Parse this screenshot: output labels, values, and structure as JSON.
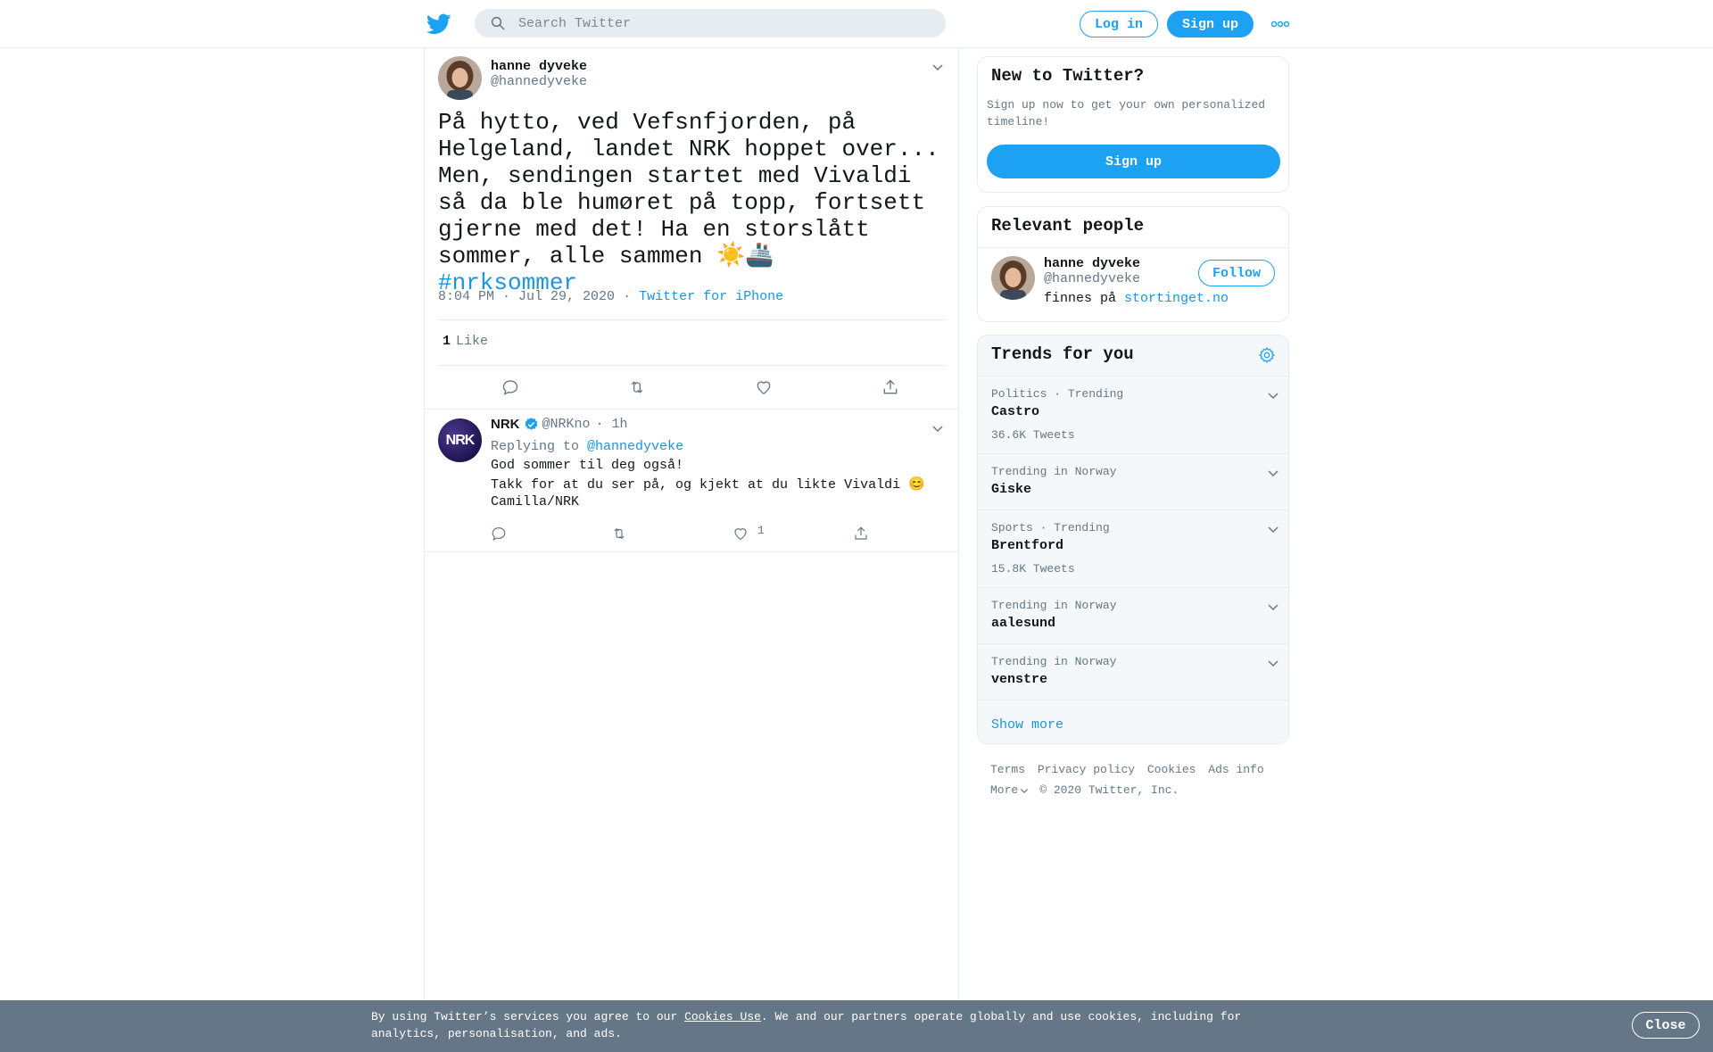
{
  "header": {
    "search_placeholder": "Search Twitter",
    "login_label": "Log in",
    "signup_label": "Sign up"
  },
  "tweet": {
    "author_name": "hanne dyveke",
    "author_handle": "@hannedyveke",
    "text": "På hytto, ved Vefsnfjorden, på Helgeland, landet NRK hoppet over...  Men, sendingen startet med Vivaldi så da ble humøret på topp, fortsett gjerne med det! Ha en storslått sommer, alle sammen ☀️🚢",
    "hashtag": "#nrksommer",
    "timestamp": "8:04 PM · Jul 29, 2020",
    "separator": "·",
    "source": "Twitter for iPhone",
    "like_count": "1",
    "like_label": "Like"
  },
  "reply": {
    "author_name": "NRK",
    "author_handle": "@NRKno",
    "time": "· 1h",
    "replying_to_label": "Replying to",
    "replying_to_handle": "@hannedyveke",
    "line1": "God sommer til deg også!",
    "line2": "Takk for at du ser på, og kjekt at du likte Vivaldi 😊",
    "line3": "Camilla/NRK",
    "like_count": "1",
    "avatar_text": "NRK"
  },
  "sidebar": {
    "new_title": "New to Twitter?",
    "new_desc": "Sign up now to get your own personalized timeline!",
    "signup_label": "Sign up",
    "relevant_title": "Relevant people",
    "person_name": "hanne dyveke",
    "person_handle": "@hannedyveke",
    "person_bio": "finnes på",
    "person_bio_link": "stortinget.no",
    "follow_label": "Follow",
    "trends_title": "Trends for you",
    "trends": [
      {
        "context": "Politics · Trending",
        "name": "Castro",
        "count": "36.6K Tweets"
      },
      {
        "context": "Trending in Norway",
        "name": "Giske",
        "count": ""
      },
      {
        "context": "Sports · Trending",
        "name": "Brentford",
        "count": "15.8K Tweets"
      },
      {
        "context": "Trending in Norway",
        "name": "aalesund",
        "count": ""
      },
      {
        "context": "Trending in Norway",
        "name": "venstre",
        "count": ""
      }
    ],
    "show_more": "Show more"
  },
  "footer": {
    "links": [
      "Terms",
      "Privacy policy",
      "Cookies",
      "Ads info"
    ],
    "more": "More",
    "copyright": "© 2020 Twitter, Inc."
  },
  "cookie": {
    "text_before": "By using Twitter’s services you agree to our ",
    "link": "Cookies Use",
    "text_after": ". We and our partners operate globally and use cookies, including for analytics, personalisation, and ads.",
    "close_label": "Close"
  },
  "colors": {
    "accent": "#1da1f2",
    "link": "#1b95e0",
    "muted": "#657786",
    "border": "#e6ecf0",
    "banner": "#657786"
  }
}
